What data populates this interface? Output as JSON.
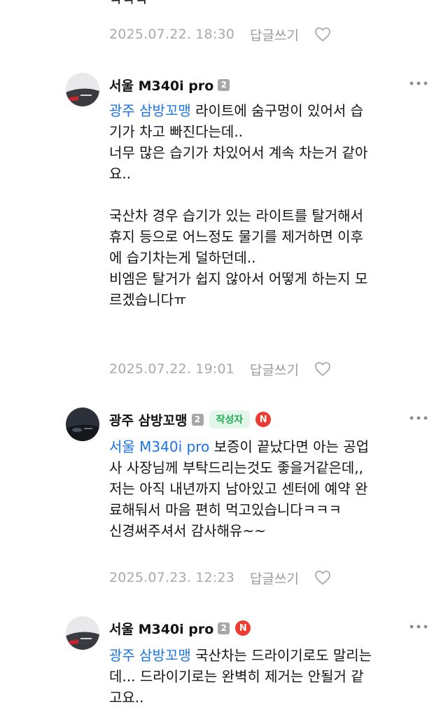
{
  "top_comment": {
    "text": "ㅋㅋㅋ",
    "date": "2025.07.22. 18:30",
    "reply_label": "답글쓰기"
  },
  "comments": [
    {
      "nickname": "서울 M340i pro",
      "level": "2",
      "mention": "광주 삼방꼬맹",
      "lines": [
        " 라이트에 숨구멍이 있어서 습",
        "기가 차고 빠진다는데..",
        "너무 많은 습기가 차있어서 계속 차는거 같아",
        "요..",
        "",
        "국산차 경우 습기가 있는 라이트를 탈거해서",
        "휴지 등으로 어느정도 물기를 제거하면 이후",
        "에 습기차는게 덜하던데..",
        "비엠은 탈거가 쉽지 않아서 어떻게 하는지 모",
        "르겠습니다ㅠ"
      ],
      "date": "2025.07.22. 19:01",
      "reply_label": "답글쓰기"
    },
    {
      "nickname": "광주 삼방꼬맹",
      "level": "2",
      "author_badge": "작성자",
      "new_badge": "N",
      "mention": "서울 M340i pro",
      "lines": [
        " 보증이 끝났다면 아는 공업",
        "사 사장님께 부탁드리는것도 좋을거같은데,,",
        "저는 아직 내년까지 남아있고 센터에 예약 완",
        "료해둬서 마음 편히 먹고있습니다ㅋㅋㅋ",
        "신경써주셔서 감사해유~~"
      ],
      "date": "2025.07.23. 12:23",
      "reply_label": "답글쓰기"
    },
    {
      "nickname": "서울 M340i pro",
      "level": "2",
      "new_badge": "N",
      "mention": "광주 삼방꼬맹",
      "lines": [
        " 국산차는 드라이기로도 말리는",
        "데... 드라이기로는 완벽히 제거는 안될거 같",
        "고요.."
      ]
    }
  ],
  "colors": {
    "mention": "#1a73e8",
    "meta": "#a9a9a9",
    "author_badge_bg": "#e3f6ea",
    "author_badge_text": "#1fae52",
    "new_badge": "#ee3b31"
  },
  "icons": [
    "heart-outline-icon",
    "more-dots-icon",
    "level-badge-icon",
    "new-badge-icon"
  ]
}
